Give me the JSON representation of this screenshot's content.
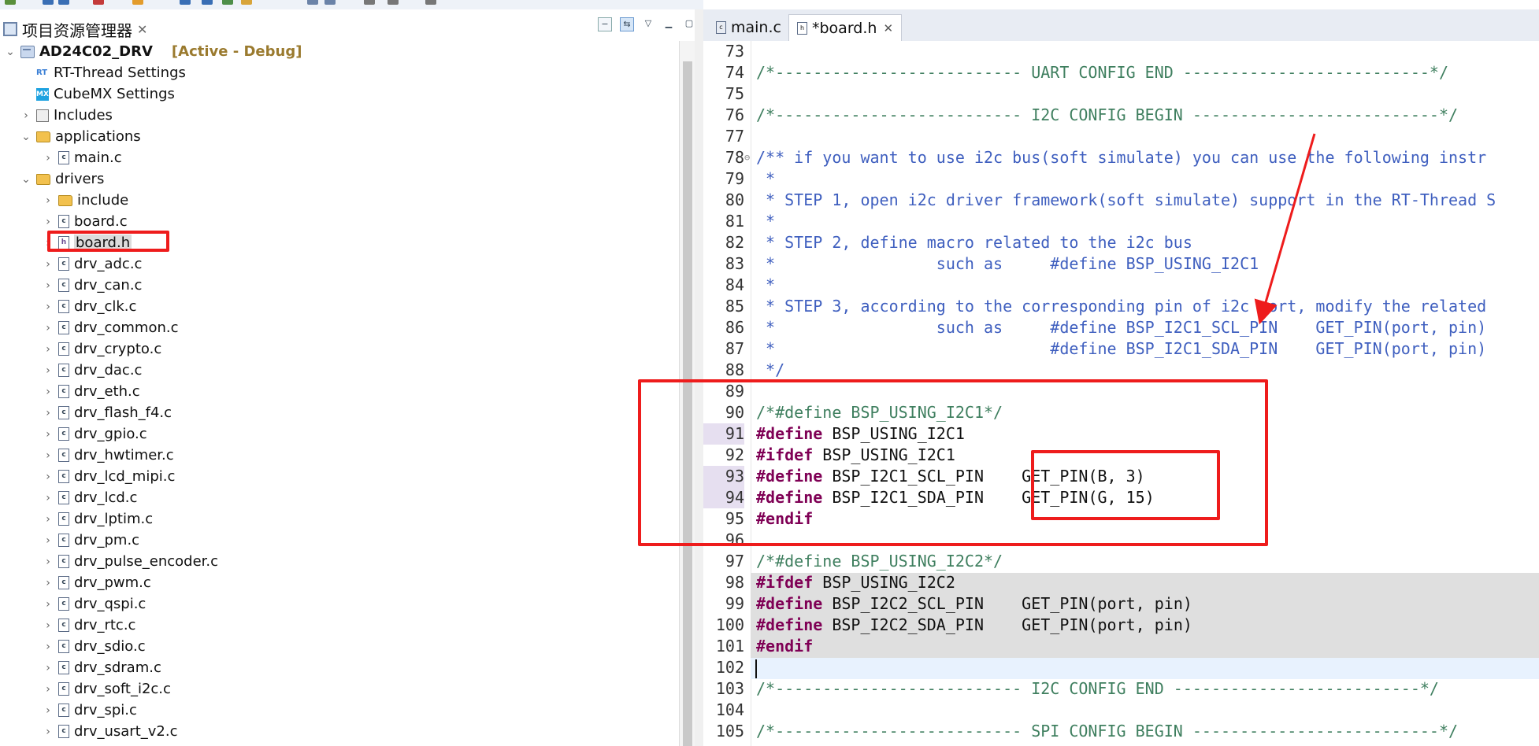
{
  "explorer": {
    "tab_label": "项目资源管理器",
    "tab_close": "✕",
    "tree": [
      {
        "label": "AD24C02_DRV",
        "status": "[Active - Debug]",
        "icon": "project-icon",
        "expanded": true
      },
      {
        "label": "RT-Thread Settings",
        "icon": "rt-thread-settings-icon",
        "icon_text": "RT"
      },
      {
        "label": "CubeMX Settings",
        "icon": "cubemx-icon",
        "icon_text": "MX"
      },
      {
        "label": "Includes",
        "icon": "includes-icon"
      },
      {
        "label": "applications",
        "icon": "folder-icon"
      },
      {
        "label": "main.c",
        "icon": "c-file-icon"
      },
      {
        "label": "drivers",
        "icon": "folder-icon"
      },
      {
        "label": "include",
        "icon": "folder-icon"
      },
      {
        "label": "board.c",
        "icon": "c-file-icon"
      },
      {
        "label": "board.h",
        "icon": "h-file-icon",
        "selected": true
      },
      {
        "label": "drv_adc.c"
      },
      {
        "label": "drv_can.c"
      },
      {
        "label": "drv_clk.c"
      },
      {
        "label": "drv_common.c"
      },
      {
        "label": "drv_crypto.c"
      },
      {
        "label": "drv_dac.c"
      },
      {
        "label": "drv_eth.c"
      },
      {
        "label": "drv_flash_f4.c"
      },
      {
        "label": "drv_gpio.c"
      },
      {
        "label": "drv_hwtimer.c"
      },
      {
        "label": "drv_lcd_mipi.c"
      },
      {
        "label": "drv_lcd.c"
      },
      {
        "label": "drv_lptim.c"
      },
      {
        "label": "drv_pm.c"
      },
      {
        "label": "drv_pulse_encoder.c"
      },
      {
        "label": "drv_pwm.c"
      },
      {
        "label": "drv_qspi.c"
      },
      {
        "label": "drv_rtc.c"
      },
      {
        "label": "drv_sdio.c"
      },
      {
        "label": "drv_sdram.c"
      },
      {
        "label": "drv_soft_i2c.c"
      },
      {
        "label": "drv_spi.c"
      },
      {
        "label": "drv_usart_v2.c"
      }
    ]
  },
  "editor": {
    "tabs": [
      {
        "label": "main.c",
        "active": false
      },
      {
        "label": "*board.h",
        "active": true,
        "close": "✕"
      }
    ],
    "lines": [
      {
        "n": "73",
        "text": ""
      },
      {
        "n": "74",
        "text": "/*-------------------------- UART CONFIG END --------------------------*/"
      },
      {
        "n": "75",
        "text": ""
      },
      {
        "n": "76",
        "text": "/*-------------------------- I2C CONFIG BEGIN --------------------------*/"
      },
      {
        "n": "77",
        "text": ""
      },
      {
        "n": "78",
        "text": "/** if you want to use i2c bus(soft simulate) you can use the following instr"
      },
      {
        "n": "79",
        "text": " *"
      },
      {
        "n": "80",
        "text": " * STEP 1, open i2c driver framework(soft simulate) support in the RT-Thread S"
      },
      {
        "n": "81",
        "text": " *"
      },
      {
        "n": "82",
        "text": " * STEP 2, define macro related to the i2c bus"
      },
      {
        "n": "83",
        "text": " *                 such as     #define BSP_USING_I2C1"
      },
      {
        "n": "84",
        "text": " *"
      },
      {
        "n": "85",
        "text": " * STEP 3, according to the corresponding pin of i2c port, modify the related"
      },
      {
        "n": "86",
        "text": " *                 such as     #define BSP_I2C1_SCL_PIN    GET_PIN(port, pin)"
      },
      {
        "n": "87",
        "text": " *                             #define BSP_I2C1_SDA_PIN    GET_PIN(port, pin)"
      },
      {
        "n": "88",
        "text": " */"
      },
      {
        "n": "89",
        "text": ""
      },
      {
        "n": "90",
        "text": "/*#define BSP_USING_I2C1*/"
      },
      {
        "n": "91",
        "kw": "#define",
        "rest": " BSP_USING_I2C1"
      },
      {
        "n": "92",
        "kw": "#ifdef",
        "rest": " BSP_USING_I2C1"
      },
      {
        "n": "93",
        "kw": "#define",
        "rest": " BSP_I2C1_SCL_PIN    GET_PIN(B, 3)"
      },
      {
        "n": "94",
        "kw": "#define",
        "rest": " BSP_I2C1_SDA_PIN    GET_PIN(G, 15)"
      },
      {
        "n": "95",
        "kw": "#endif",
        "rest": ""
      },
      {
        "n": "96",
        "text": ""
      },
      {
        "n": "97",
        "text": "/*#define BSP_USING_I2C2*/"
      },
      {
        "n": "98",
        "kw": "#ifdef",
        "rest": " BSP_USING_I2C2"
      },
      {
        "n": "99",
        "kw": "#define",
        "rest": " BSP_I2C2_SCL_PIN    GET_PIN(port, pin)"
      },
      {
        "n": "100",
        "kw": "#define",
        "rest": " BSP_I2C2_SDA_PIN    GET_PIN(port, pin)"
      },
      {
        "n": "101",
        "kw": "#endif",
        "rest": ""
      },
      {
        "n": "102",
        "text": ""
      },
      {
        "n": "103",
        "text": "/*-------------------------- I2C CONFIG END --------------------------*/"
      },
      {
        "n": "104",
        "text": ""
      },
      {
        "n": "105",
        "text": "/*-------------------------- SPI CONFIG BEGIN --------------------------*/"
      }
    ]
  },
  "colors": {
    "annotation_red": "#ee1c1c",
    "comment_green": "#3f7f5f",
    "doc_comment_blue": "#3f5fbf",
    "preprocessor_purple": "#7f0055"
  }
}
